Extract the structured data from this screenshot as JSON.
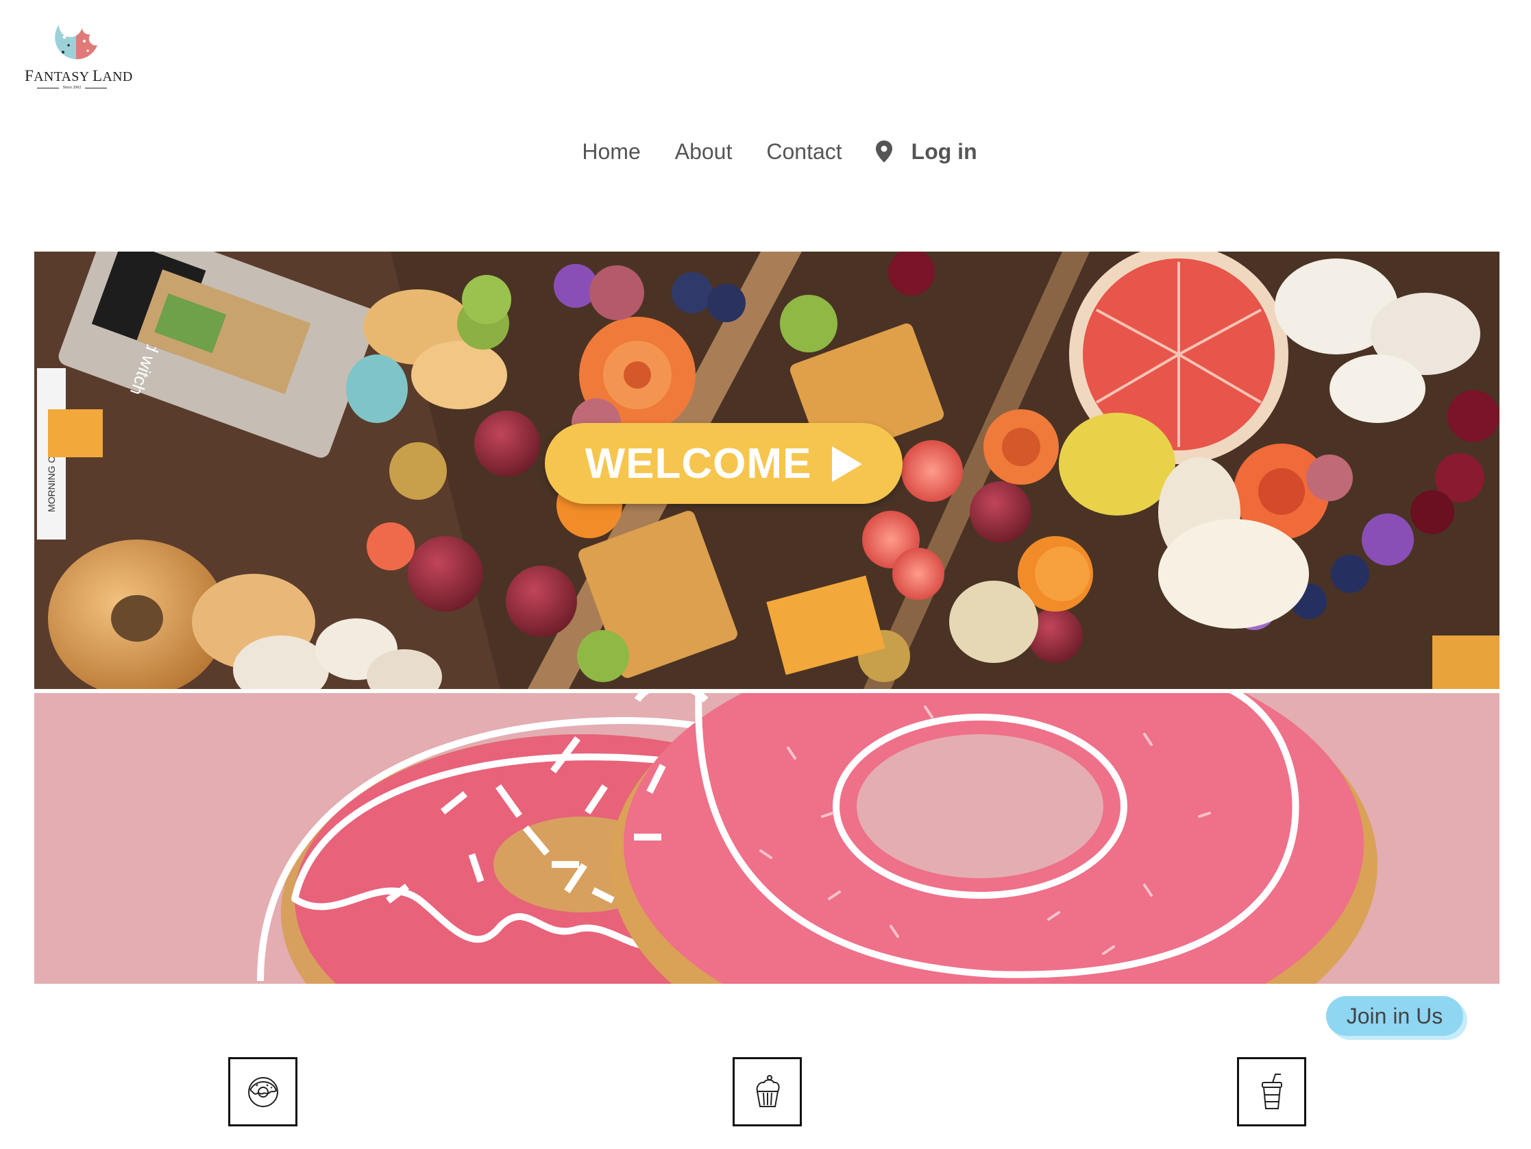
{
  "brand": {
    "name": "Fantasy Land",
    "name_first_letter": "F",
    "name_rest_1": "ANTASY ",
    "name_second_letter": "L",
    "name_rest_2": "AND",
    "tagline": "Since 2002",
    "logo_colors": {
      "left": "#9dd1d9",
      "right": "#e07a78"
    }
  },
  "nav": {
    "items": [
      {
        "label": "Home"
      },
      {
        "label": "About"
      },
      {
        "label": "Contact"
      }
    ],
    "location_icon": "map-pin-icon",
    "login_label": "Log in"
  },
  "hero": {
    "button_label": "WELCOME",
    "button_icon": "play-icon",
    "button_color": "#f6c54e",
    "image": "assorted fruit, bagels, crackers and sandwich platter",
    "package_label_1": "Sand witch",
    "package_label_2": "MORNING CHEN"
  },
  "banner": {
    "image": "pink sprinkled donuts outlined in white",
    "background_color": "#e3adb2"
  },
  "join_button": {
    "label": "Join in Us",
    "color": "#8fd6f3"
  },
  "features": [
    {
      "icon": "donut-icon"
    },
    {
      "icon": "cupcake-icon"
    },
    {
      "icon": "drink-cup-icon"
    }
  ]
}
